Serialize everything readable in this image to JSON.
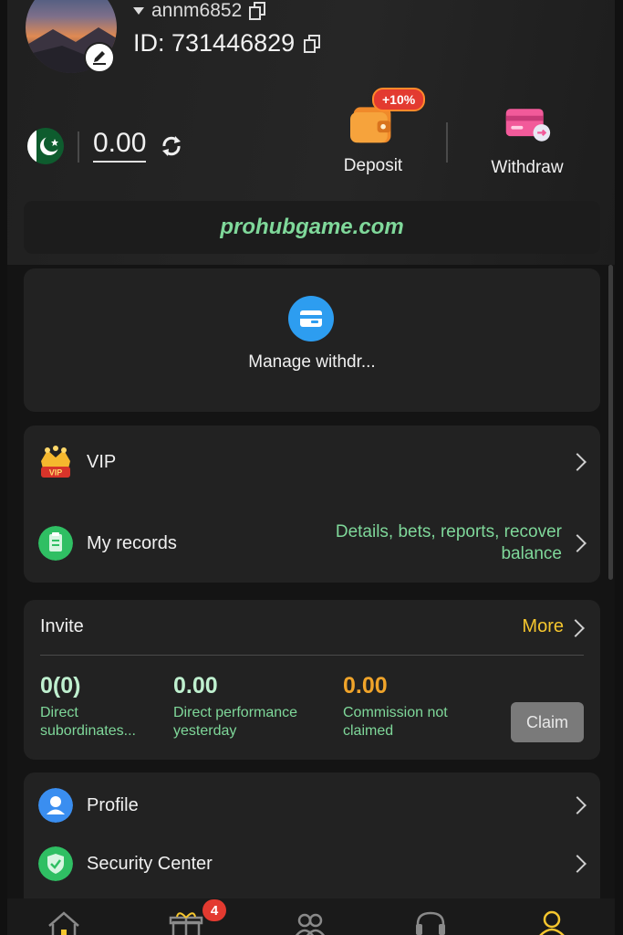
{
  "header": {
    "username": "annm6852",
    "id_label": "ID: 731446829",
    "balance": "0.00",
    "deposit_label": "Deposit",
    "deposit_promo": "+10%",
    "withdraw_label": "Withdraw"
  },
  "domain": "prohubgame.com",
  "manage_withdraw": {
    "label": "Manage withdr..."
  },
  "menu": {
    "vip": "VIP",
    "records": "My records",
    "records_note": "Details, bets, reports, recover balance"
  },
  "invite": {
    "title": "Invite",
    "more": "More",
    "stats": [
      {
        "value": "0(0)",
        "label": "Direct subordinates..."
      },
      {
        "value": "0.00",
        "label": "Direct performance yesterday"
      },
      {
        "value": "0.00",
        "label": "Commission not claimed"
      }
    ],
    "claim": "Claim"
  },
  "settings": {
    "profile": "Profile",
    "security": "Security Center"
  },
  "nav": {
    "gift_badge": "4"
  },
  "colors": {
    "accent_green": "#7fd89a",
    "accent_gold": "#f5c62e",
    "commission_orange": "#f0a42a",
    "deposit_badge": "#e33a30"
  },
  "icons": [
    "edit-icon",
    "copy-icon",
    "pakistan-flag-icon",
    "refresh-icon",
    "wallet-icon",
    "card-icon",
    "manage-withdraw-icon",
    "vip-crown-icon",
    "records-icon",
    "chevron-right-icon",
    "profile-icon",
    "shield-icon",
    "home-icon",
    "gift-icon",
    "agents-icon",
    "support-icon",
    "user-icon"
  ]
}
